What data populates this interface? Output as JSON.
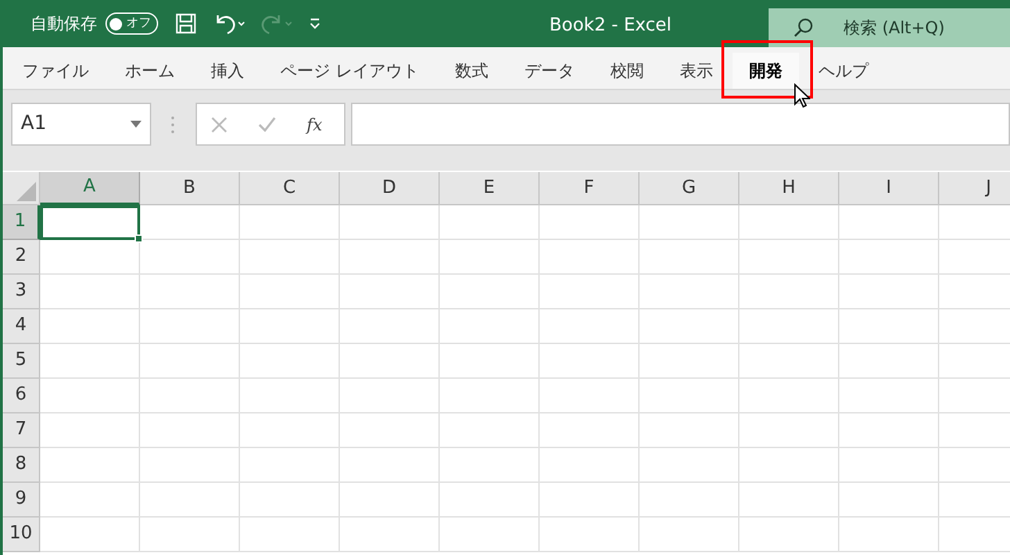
{
  "title_bar": {
    "autosave_label": "自動保存",
    "autosave_on": false,
    "autosave_state": "オフ",
    "title": "Book2  -  Excel",
    "search_placeholder": "検索 (Alt+Q)"
  },
  "ribbon_tabs": [
    {
      "label": "ファイル",
      "selected": false,
      "highlighted": false
    },
    {
      "label": "ホーム",
      "selected": false,
      "highlighted": false
    },
    {
      "label": "挿入",
      "selected": false,
      "highlighted": false
    },
    {
      "label": "ページ レイアウト",
      "selected": false,
      "highlighted": false
    },
    {
      "label": "数式",
      "selected": false,
      "highlighted": false
    },
    {
      "label": "データ",
      "selected": false,
      "highlighted": false
    },
    {
      "label": "校閲",
      "selected": false,
      "highlighted": false
    },
    {
      "label": "表示",
      "selected": false,
      "highlighted": false
    },
    {
      "label": "開発",
      "selected": true,
      "highlighted": true
    },
    {
      "label": "ヘルプ",
      "selected": false,
      "highlighted": false
    }
  ],
  "formula_bar": {
    "name_box": "A1",
    "function_label": "fx"
  },
  "sheet": {
    "columns": [
      {
        "label": "A",
        "selected": true
      },
      {
        "label": "B",
        "selected": false
      },
      {
        "label": "C",
        "selected": false
      },
      {
        "label": "D",
        "selected": false
      },
      {
        "label": "E",
        "selected": false
      },
      {
        "label": "F",
        "selected": false
      },
      {
        "label": "G",
        "selected": false
      },
      {
        "label": "H",
        "selected": false
      },
      {
        "label": "I",
        "selected": false
      },
      {
        "label": "J",
        "selected": false
      }
    ],
    "rows": [
      {
        "label": "1",
        "selected": true
      },
      {
        "label": "2",
        "selected": false
      },
      {
        "label": "3",
        "selected": false
      },
      {
        "label": "4",
        "selected": false
      },
      {
        "label": "5",
        "selected": false
      },
      {
        "label": "6",
        "selected": false
      },
      {
        "label": "7",
        "selected": false
      },
      {
        "label": "8",
        "selected": false
      },
      {
        "label": "9",
        "selected": false
      },
      {
        "label": "10",
        "selected": false
      }
    ]
  }
}
